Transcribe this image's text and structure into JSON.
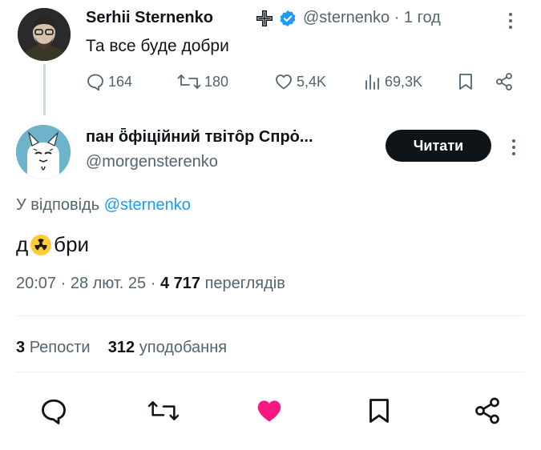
{
  "parent_tweet": {
    "display_name": "Serhii Sternenko",
    "handle": "@sternenko",
    "time": "· 1 год",
    "text": "Та все буде добри",
    "actions": {
      "replies": "164",
      "reposts": "180",
      "likes": "5,4K",
      "views": "69,3K"
    }
  },
  "main_tweet": {
    "display_name": "пан ȫфіційний твітȏр Спрȯ...",
    "handle": "@morgensterenko",
    "follow_label": "Читати",
    "reply_prefix": "У відповідь",
    "reply_mention": "@sternenko",
    "text_before": "д",
    "text_after": "бри",
    "timestamp": "20:07 · 28 лют. 25 ·",
    "views_count": "4 717",
    "views_label": "переглядів",
    "reposts_count": "3",
    "reposts_label": "Репости",
    "likes_count": "312",
    "likes_label": "уподобання"
  },
  "colors": {
    "text": "#0f1419",
    "secondary": "#536471",
    "accent": "#1d9bf0",
    "like_active": "#f91880",
    "button_bg": "#0f1419",
    "divider": "#eff3f4"
  },
  "icons": {
    "cross": "cross-icon",
    "verified": "verified-badge-icon",
    "reply": "reply-icon",
    "repost": "repost-icon",
    "like": "like-icon",
    "views": "views-icon",
    "bookmark": "bookmark-icon",
    "share": "share-icon",
    "radioactive": "radioactive-emoji-icon"
  }
}
